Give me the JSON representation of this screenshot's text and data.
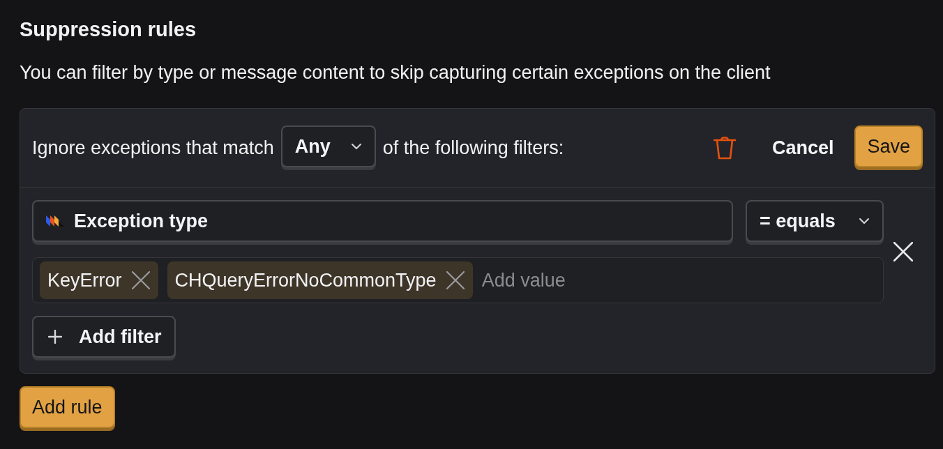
{
  "section": {
    "title": "Suppression rules",
    "description": "You can filter by type or message content to skip capturing certain exceptions on the client"
  },
  "rule": {
    "prefix": "Ignore exceptions that match",
    "match_select": {
      "value": "Any"
    },
    "suffix": "of the following filters:",
    "cancel": "Cancel",
    "save": "Save",
    "filters": [
      {
        "property": "Exception type",
        "operator": "= equals",
        "values": [
          {
            "label": "KeyError"
          },
          {
            "label": "CHQueryErrorNoCommonType"
          }
        ],
        "placeholder": "Add value"
      }
    ],
    "add_filter": "Add filter"
  },
  "add_rule": "Add rule"
}
